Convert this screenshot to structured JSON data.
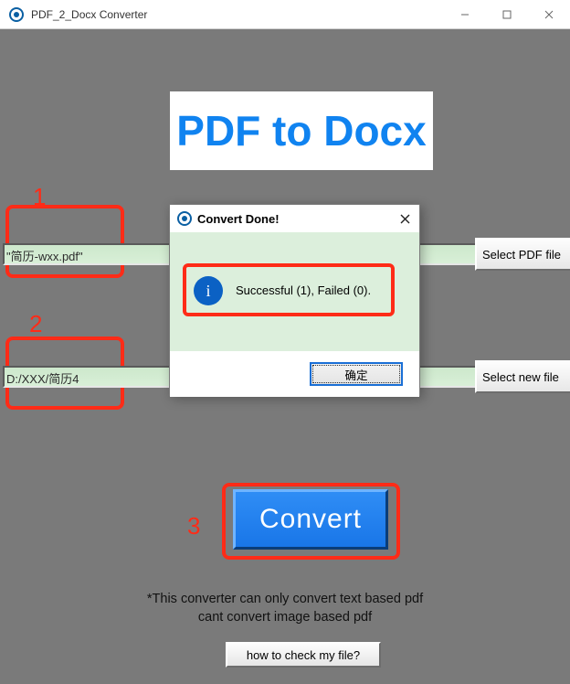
{
  "window": {
    "title": "PDF_2_Docx Converter"
  },
  "header": {
    "logo_text": "PDF to Docx"
  },
  "fields": {
    "pdf_value": "\"简历-wxx.pdf\"",
    "pdf_select_label": "Select PDF file",
    "out_value": "D:/XXX/简历4",
    "out_select_label": "Select new file"
  },
  "annotations": {
    "n1": "1",
    "n2": "2",
    "n3": "3"
  },
  "convert": {
    "label": "Convert"
  },
  "note": {
    "line1": "*This converter can only convert text based pdf",
    "line2": "cant convert image based pdf"
  },
  "howto": {
    "label": "how to check my file?"
  },
  "dialog": {
    "title": "Convert Done!",
    "message": "Successful (1), Failed (0).",
    "ok_label": "确定",
    "info_glyph": "i"
  }
}
